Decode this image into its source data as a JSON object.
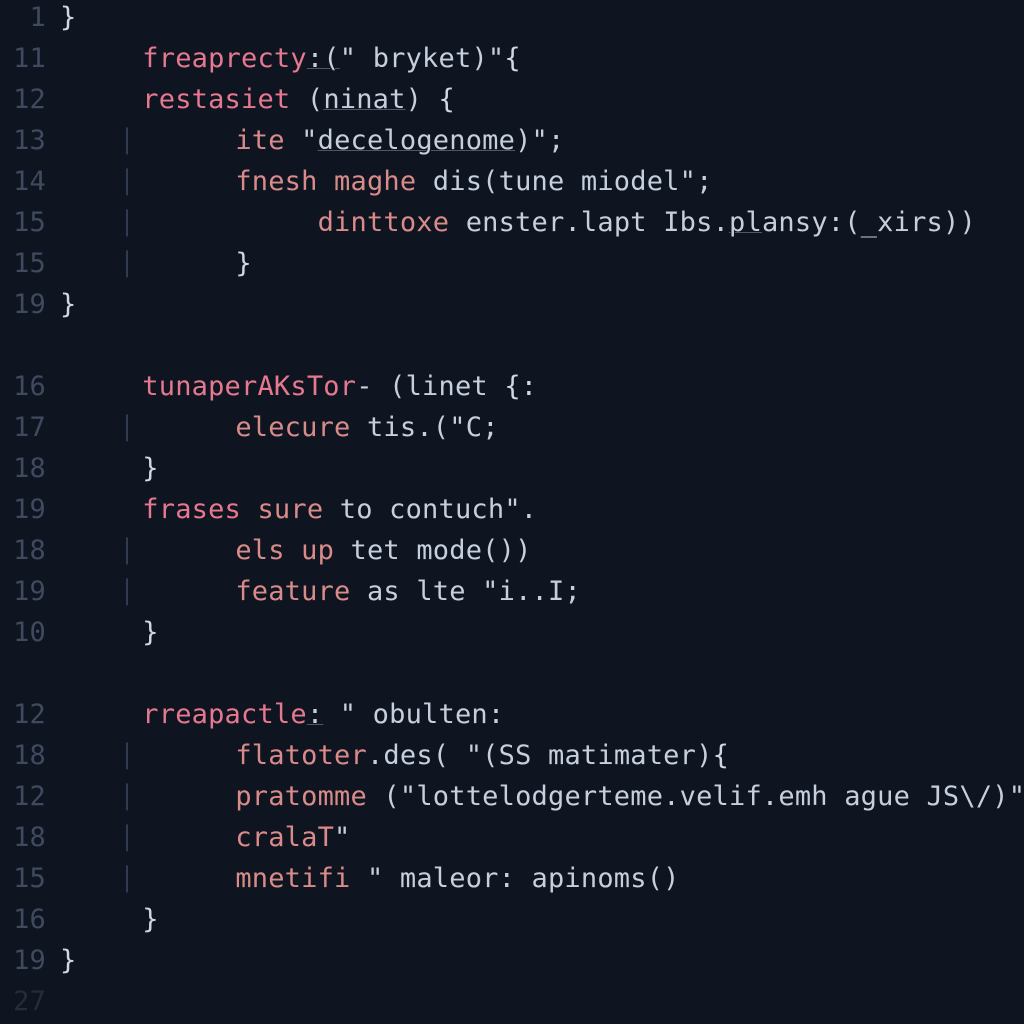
{
  "lines": [
    {
      "num": "1",
      "indent": 0,
      "tokens": [
        {
          "t": "}",
          "c": "brace"
        }
      ]
    },
    {
      "num": "11",
      "indent": 1,
      "tokens": [
        {
          "t": "freaprecty",
          "c": "kw"
        },
        {
          "t": ":(",
          "c": "id under"
        },
        {
          "t": "\"",
          "c": "id"
        },
        {
          "t": " bryket",
          "c": "id"
        },
        {
          "t": ")\"",
          "c": "id"
        },
        {
          "t": "{",
          "c": "brace"
        }
      ]
    },
    {
      "num": "12",
      "indent": 1,
      "tokens": [
        {
          "t": "restasiet",
          "c": "kw"
        },
        {
          "t": " (",
          "c": "id"
        },
        {
          "t": "ninat",
          "c": "id under"
        },
        {
          "t": ") ",
          "c": "id"
        },
        {
          "t": "{",
          "c": "brace"
        }
      ]
    },
    {
      "num": "13",
      "indent": 2,
      "guide": true,
      "tokens": [
        {
          "t": "ite",
          "c": "kw2"
        },
        {
          "t": " \"",
          "c": "id"
        },
        {
          "t": "decelogenome",
          "c": "id under"
        },
        {
          "t": ")\";",
          "c": "id"
        }
      ]
    },
    {
      "num": "14",
      "indent": 2,
      "guide": true,
      "tokens": [
        {
          "t": "fnesh",
          "c": "kw2"
        },
        {
          "t": " maghe",
          "c": "kw2"
        },
        {
          "t": " dis(",
          "c": "id"
        },
        {
          "t": "tune miodel",
          "c": "id"
        },
        {
          "t": "\";",
          "c": "id"
        }
      ]
    },
    {
      "num": "15",
      "indent": 3,
      "guide": true,
      "tokens": [
        {
          "t": "dinttoxe",
          "c": "kw2"
        },
        {
          "t": " enster",
          "c": "id"
        },
        {
          "t": ".",
          "c": "id"
        },
        {
          "t": "lapt",
          "c": "id"
        },
        {
          "t": " Ibs",
          "c": "id"
        },
        {
          "t": ".",
          "c": "id"
        },
        {
          "t": "pl",
          "c": "id under"
        },
        {
          "t": "ansy",
          "c": "id"
        },
        {
          "t": ":(",
          "c": "id"
        },
        {
          "t": "_xirs",
          "c": "id"
        },
        {
          "t": "))",
          "c": "id"
        }
      ]
    },
    {
      "num": "15",
      "indent": 2,
      "guide": true,
      "tokens": [
        {
          "t": "}",
          "c": "brace"
        }
      ]
    },
    {
      "num": "19",
      "indent": 0,
      "tokens": [
        {
          "t": "}",
          "c": "brace"
        }
      ]
    },
    {
      "num": "",
      "indent": 0,
      "tokens": []
    },
    {
      "num": "16",
      "indent": 1,
      "tokens": [
        {
          "t": "tunaperAKsTor",
          "c": "kw"
        },
        {
          "t": "-",
          "c": "id"
        },
        {
          "t": " (",
          "c": "id"
        },
        {
          "t": "linet",
          "c": "id"
        },
        {
          "t": " {:",
          "c": "brace"
        }
      ]
    },
    {
      "num": "17",
      "indent": 2,
      "guide": true,
      "tokens": [
        {
          "t": "elecure",
          "c": "kw2"
        },
        {
          "t": " tis",
          "c": "id"
        },
        {
          "t": ".(",
          "c": "id"
        },
        {
          "t": "\"C",
          "c": "id"
        },
        {
          "t": ";",
          "c": "id"
        }
      ]
    },
    {
      "num": "18",
      "indent": 1,
      "tokens": [
        {
          "t": "}",
          "c": "brace"
        }
      ]
    },
    {
      "num": "19",
      "indent": 1,
      "tokens": [
        {
          "t": "frases",
          "c": "kw"
        },
        {
          "t": " sure",
          "c": "kw2"
        },
        {
          "t": " to contuch",
          "c": "id"
        },
        {
          "t": "\".",
          "c": "id"
        }
      ]
    },
    {
      "num": "18",
      "indent": 2,
      "guide": true,
      "tokens": [
        {
          "t": "els",
          "c": "kw2"
        },
        {
          "t": " up",
          "c": "kw2"
        },
        {
          "t": " tet mode())",
          "c": "id"
        }
      ]
    },
    {
      "num": "19",
      "indent": 2,
      "guide": true,
      "tokens": [
        {
          "t": "feature",
          "c": "kw2"
        },
        {
          "t": " as lte ",
          "c": "id"
        },
        {
          "t": "\"i..I",
          "c": "id"
        },
        {
          "t": ";",
          "c": "id"
        }
      ]
    },
    {
      "num": "10",
      "indent": 1,
      "tokens": [
        {
          "t": "}",
          "c": "brace"
        }
      ]
    },
    {
      "num": "",
      "indent": 0,
      "tokens": []
    },
    {
      "num": "12",
      "indent": 1,
      "tokens": [
        {
          "t": "rreapactle",
          "c": "kw"
        },
        {
          "t": ":",
          "c": "id under"
        },
        {
          "t": " \" obulten",
          "c": "id"
        },
        {
          "t": ":",
          "c": "id"
        }
      ]
    },
    {
      "num": "18",
      "indent": 2,
      "guide": true,
      "tokens": [
        {
          "t": "flatoter",
          "c": "kw2"
        },
        {
          "t": ".des( ",
          "c": "id"
        },
        {
          "t": "\"(",
          "c": "id"
        },
        {
          "t": "SS matimater",
          "c": "id"
        },
        {
          "t": ")",
          "c": "id"
        },
        {
          "t": "{",
          "c": "brace"
        }
      ]
    },
    {
      "num": "12",
      "indent": 2,
      "guide": true,
      "tokens": [
        {
          "t": "pratomme",
          "c": "kw2"
        },
        {
          "t": " (",
          "c": "id"
        },
        {
          "t": "\"lottelodgerteme",
          "c": "id"
        },
        {
          "t": ".velif.emh ague JS\\/",
          "c": "id"
        },
        {
          "t": ")\"}",
          "c": "id"
        }
      ]
    },
    {
      "num": "18",
      "indent": 2,
      "guide": true,
      "tokens": [
        {
          "t": "cralaT",
          "c": "kw2"
        },
        {
          "t": "\"",
          "c": "id"
        }
      ]
    },
    {
      "num": "15",
      "indent": 2,
      "guide": true,
      "tokens": [
        {
          "t": "mnetifi",
          "c": "kw2"
        },
        {
          "t": " \" maleor: apinoms()",
          "c": "id"
        }
      ]
    },
    {
      "num": "16",
      "indent": 1,
      "tokens": [
        {
          "t": "}",
          "c": "brace"
        }
      ]
    },
    {
      "num": "19",
      "indent": 0,
      "tokens": [
        {
          "t": "}",
          "c": "brace"
        }
      ]
    },
    {
      "num": "27",
      "indent": 0,
      "dim": true,
      "tokens": []
    }
  ],
  "indent_unit": "     ",
  "guide_char": "⎸"
}
